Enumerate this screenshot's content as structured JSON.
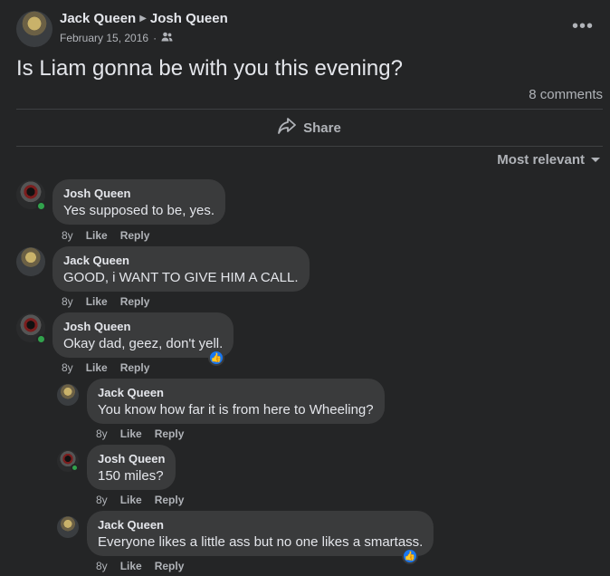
{
  "post": {
    "author": "Jack Queen",
    "recipient": "Josh Queen",
    "date": "February 15, 2016",
    "separator": "·",
    "text": "Is Liam gonna be with you this evening?",
    "comment_count": "8 comments",
    "share_label": "Share",
    "more_label": "•••"
  },
  "sort": {
    "label": "Most relevant"
  },
  "comments": [
    {
      "author": "Josh Queen",
      "text": "Yes supposed to be, yes.",
      "time": "8y",
      "like": "Like",
      "reply": "Reply"
    },
    {
      "author": "Jack Queen",
      "text": "GOOD, i WANT TO GIVE HIM A CALL.",
      "time": "8y",
      "like": "Like",
      "reply": "Reply"
    },
    {
      "author": "Josh Queen",
      "text": "Okay dad, geez, don't yell.",
      "time": "8y",
      "like": "Like",
      "reply": "Reply"
    },
    {
      "author": "Jack Queen",
      "text": "You know how far it is from here to Wheeling?",
      "time": "8y",
      "like": "Like",
      "reply": "Reply"
    },
    {
      "author": "Josh Queen",
      "text": "150 miles?",
      "time": "8y",
      "like": "Like",
      "reply": "Reply"
    },
    {
      "author": "Jack Queen",
      "text": "Everyone likes a little ass but no one likes a smartass.",
      "time": "8y",
      "like": "Like",
      "reply": "Reply"
    }
  ],
  "colors": {
    "background": "#242526",
    "bubble": "#3a3b3c",
    "like_reaction": "#1877f2",
    "online": "#31a24c"
  }
}
